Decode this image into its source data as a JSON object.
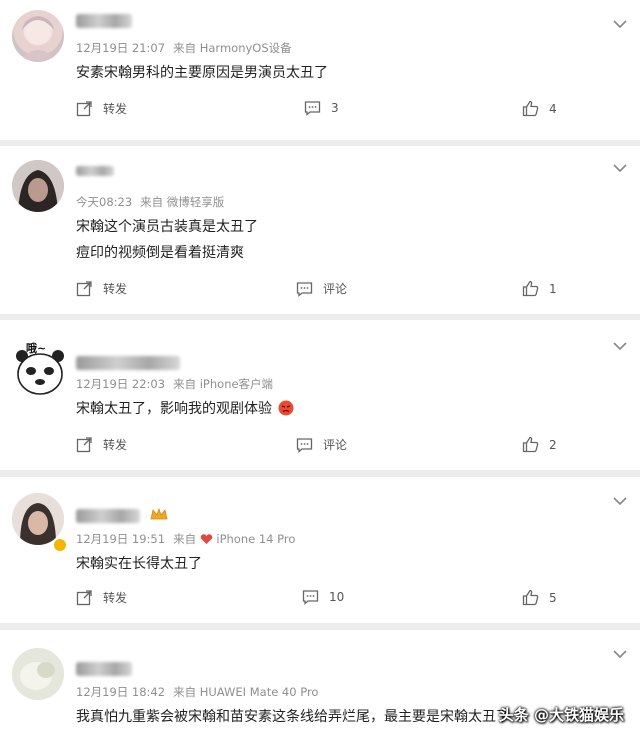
{
  "comments": [
    {
      "time": "12月19日 21:07",
      "source": "来自 HarmonyOS设备",
      "lines": [
        "安素宋翰男科的主要原因是男演员太丑了"
      ],
      "repost_label": "转发",
      "comment_label": "3",
      "like_count": "4"
    },
    {
      "time": "今天08:23",
      "source": "来自 微博轻享版",
      "lines": [
        "宋翰这个演员古装真是太丑了",
        "痘印的视频倒是看着挺清爽"
      ],
      "repost_label": "转发",
      "comment_label": "评论",
      "like_count": "1"
    },
    {
      "time": "12月19日 22:03",
      "source": "来自 iPhone客户端",
      "lines": [
        "宋翰太丑了，影响我的观剧体验"
      ],
      "repost_label": "转发",
      "comment_label": "评论",
      "like_count": "2"
    },
    {
      "time": "12月19日 19:51",
      "source": "来自",
      "device": "iPhone 14 Pro",
      "lines": [
        "宋翰实在长得太丑了"
      ],
      "repost_label": "转发",
      "comment_label": "10",
      "like_count": "5"
    },
    {
      "time": "12月19日 18:42",
      "source": "来自 HUAWEI Mate 40 Pro",
      "lines": [
        "我真怕九重紫会被宋翰和苗安素这条线给弄烂尾，最主要是宋翰太丑了"
      ],
      "repost_label": "",
      "comment_label": "",
      "like_count": ""
    }
  ],
  "avatar3_caption": "哦~",
  "watermark": "头条 @大铁猫娱乐",
  "colors": {
    "background": "#ececec",
    "card": "#ffffff",
    "meta_text": "#8f8f8f",
    "body_text": "#222222",
    "icon": "#666666"
  }
}
